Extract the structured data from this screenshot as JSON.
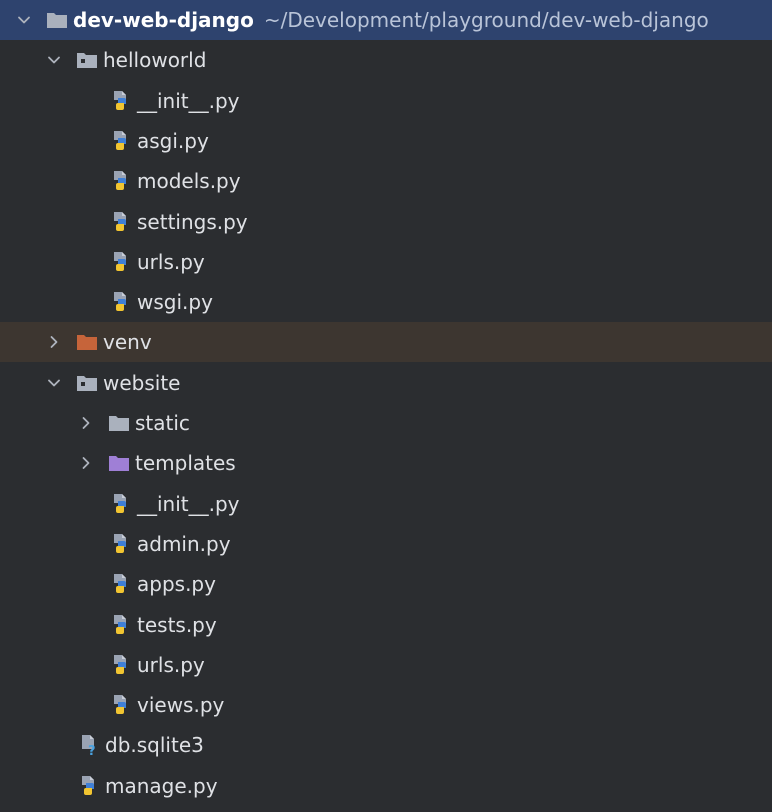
{
  "colors": {
    "background": "#2b2d30",
    "selected_row": "#2e436e",
    "excluded_row": "#3d3630",
    "folder": "#aab1bd",
    "folder_excluded": "#c6643a",
    "folder_templates": "#9f7fd6",
    "python_blue": "#3f7fd6",
    "python_yellow": "#f2c531",
    "question": "#4aa2e0"
  },
  "tree": [
    {
      "label": "dev-web-django",
      "path": "~/Development/playground/dev-web-django",
      "type": "folder",
      "icon": "folder-icon",
      "expanded": true,
      "depth": 0,
      "selected": true
    },
    {
      "label": "helloworld",
      "type": "package",
      "icon": "package-folder-icon",
      "expanded": true,
      "depth": 1
    },
    {
      "label": "__init__.py",
      "type": "python",
      "icon": "python-file-icon",
      "depth": 2
    },
    {
      "label": "asgi.py",
      "type": "python",
      "icon": "python-file-icon",
      "depth": 2
    },
    {
      "label": "models.py",
      "type": "python",
      "icon": "python-file-icon",
      "depth": 2
    },
    {
      "label": "settings.py",
      "type": "python",
      "icon": "python-file-icon",
      "depth": 2
    },
    {
      "label": "urls.py",
      "type": "python",
      "icon": "python-file-icon",
      "depth": 2
    },
    {
      "label": "wsgi.py",
      "type": "python",
      "icon": "python-file-icon",
      "depth": 2
    },
    {
      "label": "venv",
      "type": "excluded-folder",
      "icon": "excluded-folder-icon",
      "expanded": false,
      "depth": 1,
      "excluded": true
    },
    {
      "label": "website",
      "type": "package",
      "icon": "package-folder-icon",
      "expanded": true,
      "depth": 1
    },
    {
      "label": "static",
      "type": "folder",
      "icon": "folder-icon",
      "expanded": false,
      "depth": 2
    },
    {
      "label": "templates",
      "type": "templates-folder",
      "icon": "templates-folder-icon",
      "expanded": false,
      "depth": 2
    },
    {
      "label": "__init__.py",
      "type": "python",
      "icon": "python-file-icon",
      "depth": 3
    },
    {
      "label": "admin.py",
      "type": "python",
      "icon": "python-file-icon",
      "depth": 3
    },
    {
      "label": "apps.py",
      "type": "python",
      "icon": "python-file-icon",
      "depth": 3
    },
    {
      "label": "tests.py",
      "type": "python",
      "icon": "python-file-icon",
      "depth": 3
    },
    {
      "label": "urls.py",
      "type": "python",
      "icon": "python-file-icon",
      "depth": 3
    },
    {
      "label": "views.py",
      "type": "python",
      "icon": "python-file-icon",
      "depth": 3
    },
    {
      "label": "db.sqlite3",
      "type": "unknown",
      "icon": "unknown-file-icon",
      "depth": 2
    },
    {
      "label": "manage.py",
      "type": "python",
      "icon": "python-file-icon",
      "depth": 2
    }
  ]
}
